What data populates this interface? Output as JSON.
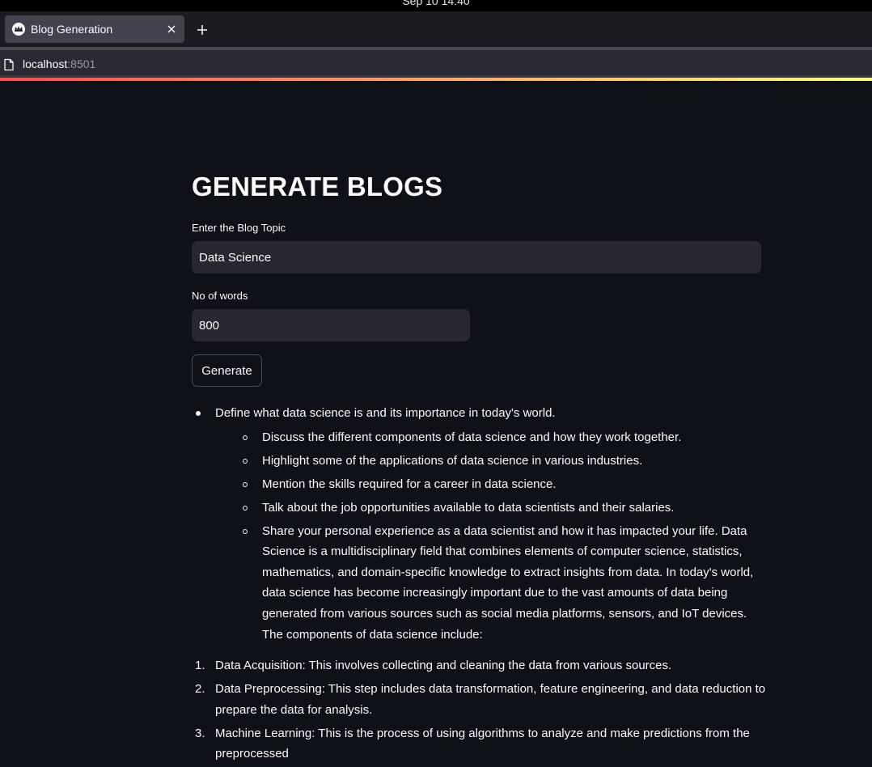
{
  "os": {
    "clock": "Sep 10  14:40"
  },
  "browser": {
    "tab_title": "Blog Generation",
    "url_host": "localhost",
    "url_port": ":8501"
  },
  "app": {
    "title": "GENERATE BLOGS",
    "topic_label": "Enter the Blog Topic",
    "topic_value": "Data Science",
    "words_label": "No of words",
    "words_value": "800",
    "generate_label": "Generate"
  },
  "output": {
    "main_bullet": "Define what data science is and its importance in today's world.",
    "sub_bullets": [
      "Discuss the different components of data science and how they work together.",
      "Highlight some of the applications of data science in various industries.",
      "Mention the skills required for a career in data science.",
      "Talk about the job opportunities available to data scientists and their salaries.",
      "Share your personal experience as a data scientist and how it has impacted your life. Data Science is a multidisciplinary field that combines elements of computer science, statistics, mathematics, and domain-specific knowledge to extract insights from data. In today's world, data science has become increasingly important due to the vast amounts of data being generated from various sources such as social media platforms, sensors, and IoT devices. The components of data science include:"
    ],
    "numbered": [
      {
        "n": "1.",
        "text": "Data Acquisition: This involves collecting and cleaning the data from various sources."
      },
      {
        "n": "2.",
        "text": "Data Preprocessing: This step includes data transformation, feature engineering, and data reduction to prepare the data for analysis."
      },
      {
        "n": "3.",
        "text": "Machine Learning: This is the process of using algorithms to analyze and make predictions from the preprocessed"
      }
    ]
  },
  "colors": {
    "background": "#0e1117",
    "input_bg": "#262730",
    "accent_start": "#ff4b4b",
    "accent_end": "#fffd80"
  },
  "icons": {
    "favicon": "streamlit-crown-icon",
    "close": "close-icon",
    "new_tab": "plus-icon",
    "page": "page-icon"
  }
}
